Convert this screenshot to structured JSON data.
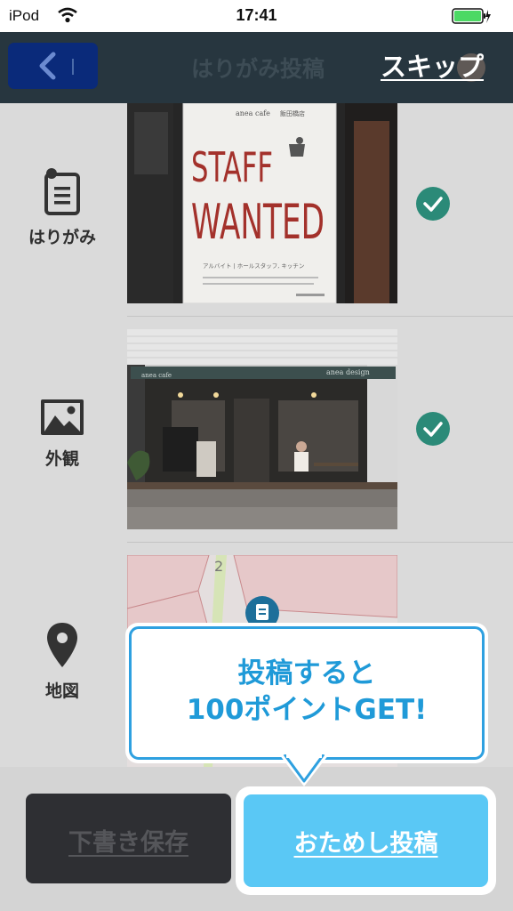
{
  "status_bar": {
    "carrier": "iPod",
    "time": "17:41"
  },
  "nav": {
    "title": "はりがみ投稿",
    "skip_label": "スキップ"
  },
  "categories": [
    {
      "label": "はりがみ",
      "icon": "flyer-icon",
      "checked": true
    },
    {
      "label": "外観",
      "icon": "image-icon",
      "checked": true
    },
    {
      "label": "地図",
      "icon": "map-pin-icon",
      "checked": false
    }
  ],
  "photos": {
    "flyer": {
      "shop_name": "anea cafe",
      "branch": "飯田橋店",
      "headline_1": "STAFF",
      "headline_2": "WANTED",
      "detail": "アルバイト | ホールスタッフ, キッチン"
    },
    "exterior": {
      "sign": "anea design",
      "awning": "anea cafe"
    }
  },
  "tooltip": {
    "line1": "投稿すると",
    "line2": "100ポイントGET!"
  },
  "bottom": {
    "draft_label": "下書き保存",
    "post_label": "おためし投稿"
  },
  "colors": {
    "nav_bg": "#27363f",
    "accent": "#5ac8f5",
    "check": "#2b8a78",
    "tooltip_text": "#1f9ad8"
  }
}
